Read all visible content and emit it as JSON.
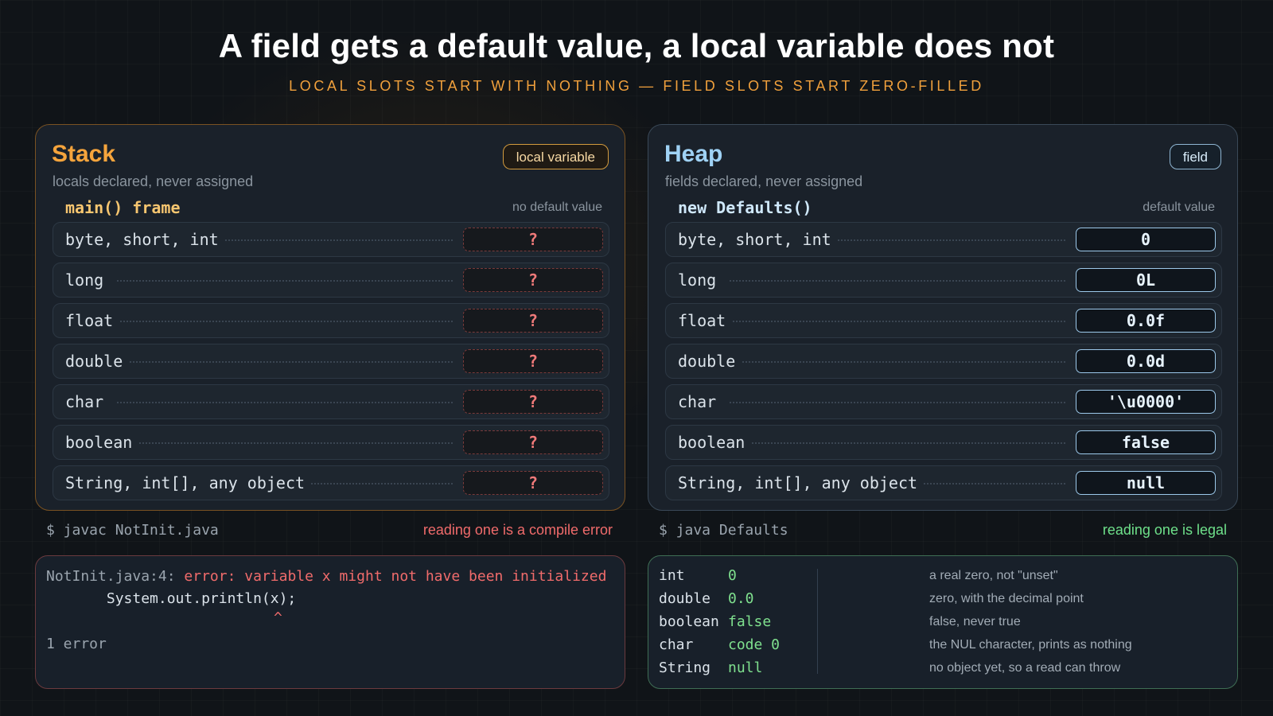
{
  "title": "A field gets a default value, a local variable does not",
  "subtitle": "LOCAL SLOTS START WITH NOTHING — FIELD SLOTS START ZERO-FILLED",
  "stack": {
    "title": "Stack",
    "subtitle": "locals declared, never assigned",
    "badge": "local variable",
    "frame": "main() frame",
    "note": "no default value",
    "rows": [
      {
        "type": "byte, short, int",
        "value": "?"
      },
      {
        "type": "long",
        "value": "?"
      },
      {
        "type": "float",
        "value": "?"
      },
      {
        "type": "double",
        "value": "?"
      },
      {
        "type": "char",
        "value": "?"
      },
      {
        "type": "boolean",
        "value": "?"
      },
      {
        "type": "String, int[], any object",
        "value": "?"
      }
    ]
  },
  "heap": {
    "title": "Heap",
    "subtitle": "fields declared, never assigned",
    "badge": "field",
    "frame": "new Defaults()",
    "note": "default value",
    "rows": [
      {
        "type": "byte, short, int",
        "value": "0"
      },
      {
        "type": "long",
        "value": "0L"
      },
      {
        "type": "float",
        "value": "0.0f"
      },
      {
        "type": "double",
        "value": "0.0d"
      },
      {
        "type": "char",
        "value": "'\\u0000'"
      },
      {
        "type": "boolean",
        "value": "false"
      },
      {
        "type": "String, int[], any object",
        "value": "null"
      }
    ]
  },
  "compile": {
    "command": "$ javac NotInit.java",
    "verdict": "reading one is a compile error",
    "error_location": "NotInit.java:4:",
    "error_message": "error: variable x might not have been initialized",
    "source_line": "       System.out.println(x);",
    "caret": "^",
    "summary": "1 error"
  },
  "run": {
    "command": "$ java Defaults",
    "verdict": "reading one is legal",
    "output": [
      {
        "type": "int",
        "value": "0",
        "note": "a real zero, not \"unset\""
      },
      {
        "type": "double",
        "value": "0.0",
        "note": "zero, with the decimal point"
      },
      {
        "type": "boolean",
        "value": "false",
        "note": "false, never true"
      },
      {
        "type": "char",
        "value": "code 0",
        "note": "the NUL character, prints as nothing"
      },
      {
        "type": "String",
        "value": "null",
        "note": "no object yet, so a read can throw"
      }
    ]
  },
  "colors": {
    "stack_accent": "#f5a43c",
    "heap_accent": "#9fd2f5",
    "error": "#f06b6b",
    "ok": "#6ee08a"
  }
}
